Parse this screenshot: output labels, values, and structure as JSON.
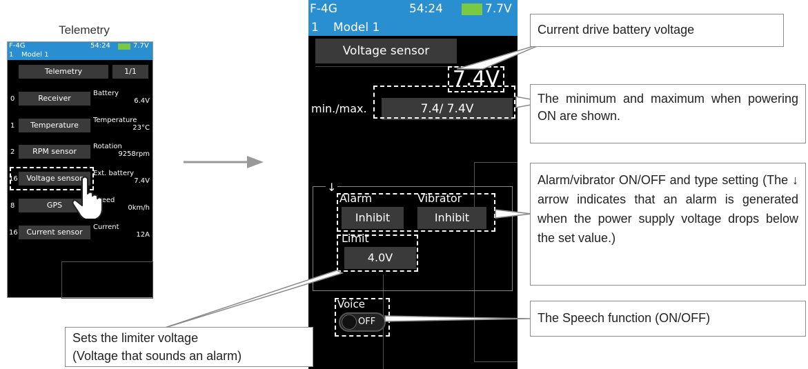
{
  "small": {
    "title": "Telemetry",
    "status": {
      "mode": "F-4G",
      "time": "54:24",
      "voltage": "7.7V"
    },
    "model": {
      "number": "1",
      "name": "Model 1"
    },
    "header": {
      "title": "Telemetry",
      "page": "1/1"
    },
    "rows": [
      {
        "num": "0",
        "label": "Receiver",
        "key": "Battery",
        "value": "6.4V"
      },
      {
        "num": "1",
        "label": "Temperature",
        "key": "Temperature",
        "value": "23°C"
      },
      {
        "num": "2",
        "label": "RPM sensor",
        "key": "Rotation",
        "value": "9258rpm"
      },
      {
        "num": "16",
        "label": "Voltage sensor",
        "key": "Ext. battery",
        "value": "7.4V"
      },
      {
        "num": "8",
        "label": "GPS",
        "key": "Speed",
        "value": "0km/h"
      },
      {
        "num": "16",
        "label": "Current sensor",
        "key": "Current",
        "value": "12A"
      }
    ]
  },
  "big": {
    "status": {
      "mode": "F-4G",
      "time": "54:24",
      "voltage": "7.7V"
    },
    "model": {
      "number": "1",
      "name": "Model 1"
    },
    "header": "Voltage sensor",
    "voltage": "7.4V",
    "minmax_label": "min./max.",
    "minmax_value": "7.4/ 7.4V",
    "alarm_label": "Alarm",
    "alarm_value": "Inhibit",
    "vibrator_label": "Vibrator",
    "vibrator_value": "Inhibit",
    "limit_label": "Limit",
    "limit_value": "4.0V",
    "voice_label": "Voice",
    "voice_value": "OFF",
    "arrow": "↓"
  },
  "callouts": {
    "current": "Current drive battery voltage",
    "minmax": "The minimum and maximum when powering ON are shown.",
    "alarm": "Alarm/vibrator ON/OFF and type setting (The ↓ arrow indicates that an alarm is generated when the power supply voltage drops below the set value.)",
    "speech": "The Speech function (ON/OFF)",
    "limiter_line1": "Sets the limiter voltage",
    "limiter_line2": "(Voltage that sounds an alarm)"
  },
  "colors": {
    "blue_bar": "#2a8fd1",
    "screen": "#000000",
    "button": "#3a3a3a",
    "battery": "#7ac943"
  }
}
